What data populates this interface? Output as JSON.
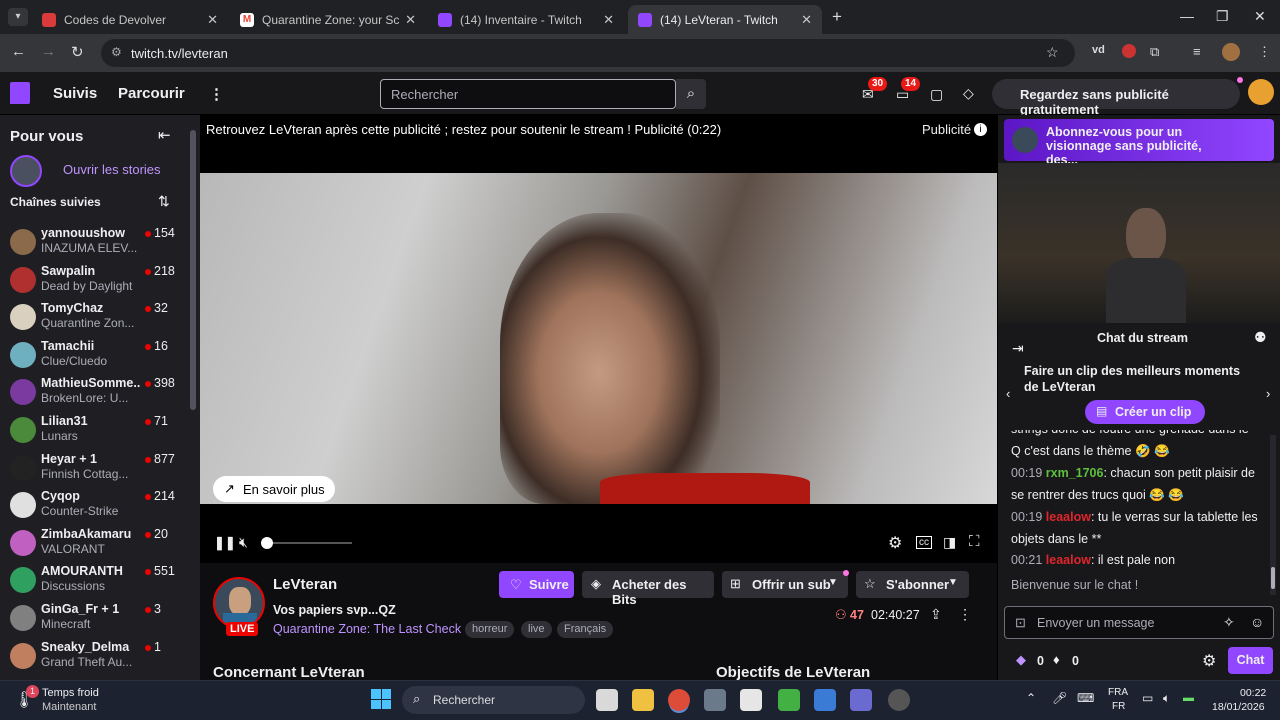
{
  "browser": {
    "tabs": [
      {
        "label": "Codes de Devolver",
        "color": "#d93a3a"
      },
      {
        "label": "Quarantine Zone: your Scanner",
        "color": "#ea4335"
      },
      {
        "label": "(14) Inventaire - Twitch",
        "color": "#9146ff"
      },
      {
        "label": "(14) LeVteran - Twitch",
        "color": "#9146ff"
      }
    ],
    "url": "twitch.tv/levteran",
    "new_tab": "+",
    "ext_label": "vd"
  },
  "twitch": {
    "nav": {
      "follows": "Suivis",
      "browse": "Parcourir",
      "more": "⋮"
    },
    "search_placeholder": "Rechercher",
    "badges": {
      "inbox": "30",
      "drops": "14"
    },
    "adfree_label": "Regardez sans publicité gratuitement",
    "accent": "#9146ff"
  },
  "sidebar": {
    "title": "Pour vous",
    "stories": "Ouvrir les stories",
    "followed_header": "Chaînes suivies",
    "channels": [
      {
        "name": "yannouushow",
        "game": "INAZUMA ELEV...",
        "viewers": "154",
        "color": "#8a6a4a"
      },
      {
        "name": "Sawpalin",
        "game": "Dead by Daylight",
        "viewers": "218",
        "color": "#b03030"
      },
      {
        "name": "TomyChaz",
        "game": "Quarantine Zon...",
        "viewers": "32",
        "color": "#d9d0c0"
      },
      {
        "name": "Tamachii",
        "game": "Clue/Cluedo",
        "viewers": "16",
        "color": "#6fb0c0"
      },
      {
        "name": "MathieuSomme...",
        "game": "BrokenLore: U...",
        "viewers": "398",
        "color": "#7a3aa0"
      },
      {
        "name": "Lilian31",
        "game": "Lunars",
        "viewers": "71",
        "color": "#4a8a3a"
      },
      {
        "name": "Heyar + 1",
        "game": "Finnish Cottag...",
        "viewers": "877",
        "color": "#222"
      },
      {
        "name": "Cyqop",
        "game": "Counter-Strike",
        "viewers": "214",
        "color": "#e0e0e0"
      },
      {
        "name": "ZimbaAkamaru",
        "game": "VALORANT",
        "viewers": "20",
        "color": "#c060c0"
      },
      {
        "name": "AMOURANTH",
        "game": "Discussions",
        "viewers": "551",
        "color": "#30a060"
      },
      {
        "name": "GinGa_Fr + 1",
        "game": "Minecraft",
        "viewers": "3",
        "color": "#808080"
      },
      {
        "name": "Sneaky_Delma",
        "game": "Grand Theft Au...",
        "viewers": "1",
        "color": "#c08060"
      }
    ]
  },
  "player": {
    "ad_message": "Retrouvez LeVteran après cette publicité ; restez pour soutenir le stream ! Publicité (0:22)",
    "ad_label": "Publicité",
    "learn_more": "En savoir plus"
  },
  "stream": {
    "channel": "LeVteran",
    "title": "Vos papiers svp...QZ",
    "game": "Quarantine Zone: The Last Check",
    "live": "LIVE",
    "tags": [
      "horreur",
      "live",
      "Français"
    ],
    "follow": "Suivre",
    "bits": "Acheter des Bits",
    "gift": "Offrir un sub",
    "subscribe": "S'abonner",
    "viewers": "47",
    "uptime": "02:40:27",
    "about": "Concernant LeVteran",
    "goals": "Objectifs de LeVteran"
  },
  "chat": {
    "promo": "Abonnez-vous pour un visionnage sans publicité, des...",
    "title": "Chat du stream",
    "clip_prompt": "Faire un clip des meilleurs moments de LeVteran",
    "clip_button": "Créer un clip",
    "messages": [
      {
        "time": "",
        "user": "",
        "color": "#efeff1",
        "text": "strings donc de foutre une grenade dans le Q c'est dans le thème 🤣 😂"
      },
      {
        "time": "00:19",
        "user": "rxm_1706",
        "color": "#5fbf3f",
        "text": ": chacun son petit plaisir de se rentrer des trucs quoi 😂 😂"
      },
      {
        "time": "00:19",
        "user": "leaalow",
        "color": "#e0252b",
        "text": ": tu le verras sur la tablette les objets dans le **"
      },
      {
        "time": "00:21",
        "user": "leaalow",
        "color": "#e0252b",
        "text": ": il est pale non"
      },
      {
        "time": "",
        "user": "",
        "color": "#efeff1",
        "text": "Bienvenue sur le chat !"
      }
    ],
    "input_placeholder": "Envoyer un message",
    "points": "0",
    "bits": "0",
    "send": "Chat"
  },
  "taskbar": {
    "weather_title": "Temps froid",
    "weather_sub": "Maintenant",
    "weather_badge": "1",
    "search": "Rechercher",
    "lang1": "FRA",
    "lang2": "FR",
    "time": "00:22",
    "date": "18/01/2026"
  }
}
